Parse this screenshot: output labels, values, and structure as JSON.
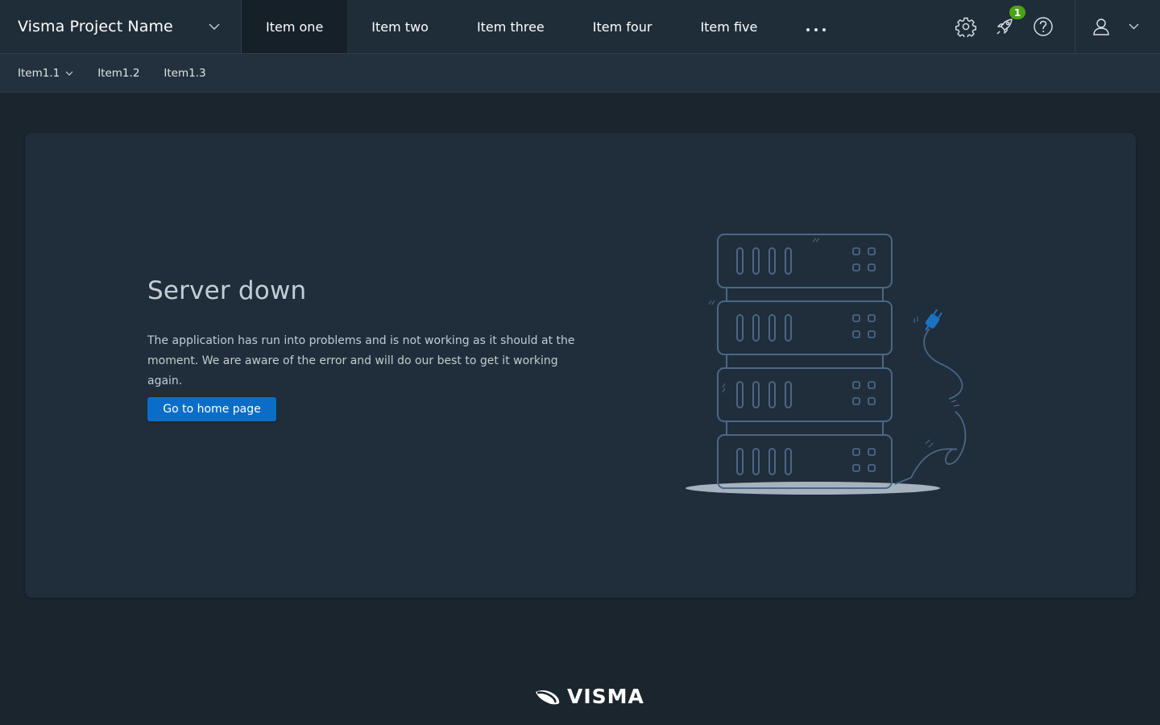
{
  "brand": {
    "name": "Visma Project Name"
  },
  "nav": {
    "items": [
      {
        "label": "Item one",
        "active": true
      },
      {
        "label": "Item two",
        "active": false
      },
      {
        "label": "Item three",
        "active": false
      },
      {
        "label": "Item four",
        "active": false
      },
      {
        "label": "Item five",
        "active": false
      }
    ],
    "more_icon": "ellipsis-icon"
  },
  "tools": {
    "settings_icon": "gear-icon",
    "notifications_icon": "rocket-icon",
    "notification_count": "1",
    "help_icon": "help-icon",
    "user_icon": "user-icon"
  },
  "subnav": {
    "items": [
      {
        "label": "Item1.1",
        "has_dropdown": true
      },
      {
        "label": "Item1.2",
        "has_dropdown": false
      },
      {
        "label": "Item1.3",
        "has_dropdown": false
      }
    ]
  },
  "error": {
    "title": "Server down",
    "message": "The application has run into problems and is not working as it should at the moment. We are aware of the error and will do our best to get it working again.",
    "button_label": "Go to home page",
    "illustration": "server-unplugged-illustration"
  },
  "footer": {
    "logo_text": "VISMA"
  },
  "colors": {
    "background": "#1a252e",
    "navbar": "#1f2d38",
    "panel": "#1f2e3a",
    "primary_button": "#0a6ec8",
    "badge": "#4ba314"
  }
}
